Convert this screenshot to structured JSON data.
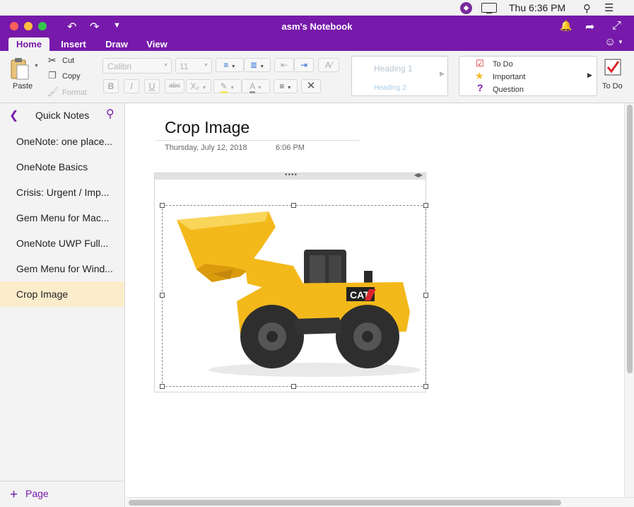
{
  "menubar": {
    "clock": "Thu 6:36 PM"
  },
  "window": {
    "title": "asm's Notebook",
    "traffic_colors": [
      "#fc605c",
      "#fdbc40",
      "#34c84a"
    ]
  },
  "ribbon_tabs": [
    {
      "label": "Home",
      "active": true
    },
    {
      "label": "Insert",
      "active": false
    },
    {
      "label": "Draw",
      "active": false
    },
    {
      "label": "View",
      "active": false
    }
  ],
  "clipboard": {
    "paste": "Paste",
    "cut": "Cut",
    "copy": "Copy",
    "format": "Format"
  },
  "font": {
    "family": "Calibri",
    "size": "11"
  },
  "styles": {
    "heading1": "Heading 1",
    "heading2": "Heading 2"
  },
  "tags": {
    "todo": "To Do",
    "important": "Important",
    "question": "Question",
    "todo_button": "To Do"
  },
  "sidebar": {
    "title": "Quick Notes",
    "pages": [
      {
        "label": "OneNote: one place...",
        "active": false
      },
      {
        "label": "OneNote Basics",
        "active": false
      },
      {
        "label": "Crisis: Urgent / Imp...",
        "active": false
      },
      {
        "label": "Gem Menu for Mac...",
        "active": false
      },
      {
        "label": "OneNote UWP Full...",
        "active": false
      },
      {
        "label": "Gem Menu for Wind...",
        "active": false
      },
      {
        "label": "Crop Image",
        "active": true
      }
    ],
    "add_page": "Page"
  },
  "page": {
    "title": "Crop Image",
    "date": "Thursday, July 12, 2018",
    "time": "6:06 PM",
    "image_alt": "CAT toy wheel loader",
    "image_brand_text": "CAT"
  },
  "colors": {
    "accent": "#7719aa",
    "selected_page": "#fbeccb",
    "loader_yellow": "#f3b91b"
  }
}
